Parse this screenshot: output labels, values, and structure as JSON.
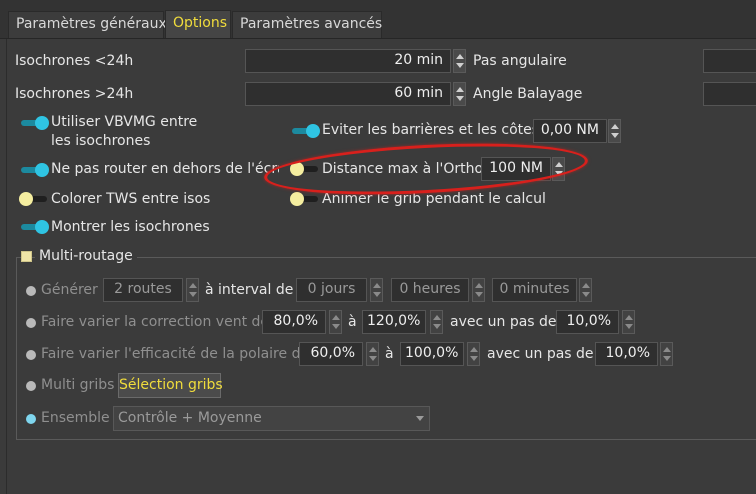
{
  "tabs": [
    {
      "label": "Paramètres généraux"
    },
    {
      "label": "Options"
    },
    {
      "label": "Paramètres avancés"
    }
  ],
  "isochrones_lt24": {
    "label": "Isochrones <24h",
    "value": "20 min"
  },
  "isochrones_gt24": {
    "label": "Isochrones >24h",
    "value": "60 min"
  },
  "pas_angulaire": {
    "label": "Pas angulaire",
    "value": ""
  },
  "angle_balayage": {
    "label": "Angle Balayage",
    "value": ""
  },
  "options": {
    "vbvmg": {
      "label_line1": "Utiliser VBVMG entre",
      "label_line2": "les isochrones",
      "on": true
    },
    "ne_pas_router": {
      "label": "Ne pas router en dehors de l'écran",
      "on": true
    },
    "colorer_tws": {
      "label": "Colorer TWS entre isos",
      "on": false
    },
    "montrer_iso": {
      "label": "Montrer les isochrones",
      "on": true
    },
    "eviter_barrieres": {
      "label": "Eviter les barrières et les côtes",
      "on": true,
      "value": "0,00 NM"
    },
    "distance_ortho": {
      "label": "Distance max à l'Ortho",
      "on": false,
      "value": "100 NM"
    },
    "animer_grib": {
      "label": "Animer le grib pendant le calcul",
      "on": false
    }
  },
  "multi": {
    "title": "Multi-routage",
    "generer": {
      "label": "Générer",
      "routes": "2 routes",
      "interval_label": "à interval de",
      "jours": "0 jours",
      "heures": "0 heures",
      "minutes": "0 minutes"
    },
    "correction": {
      "label": "Faire varier la correction vent de",
      "from": "80,0%",
      "a": "à",
      "to": "120,0%",
      "pas_label": "avec un pas de",
      "pas": "10,0%"
    },
    "efficacite": {
      "label": "Faire varier l'efficacité de la polaire de",
      "from": "60,0%",
      "a": "à",
      "to": "100,0%",
      "pas_label": "avec un pas de",
      "pas": "10,0%"
    },
    "multi_gribs": {
      "label": "Multi gribs",
      "button": "Sélection gribs"
    },
    "ensemble": {
      "label": "Ensemble",
      "value": "Contrôle + Moyenne"
    }
  },
  "colors": {
    "accent_tab": "#f0dc3c",
    "toggle_on": "#2fc4e3",
    "toggle_off": "#f5eea0",
    "highlight": "#d8201c"
  }
}
